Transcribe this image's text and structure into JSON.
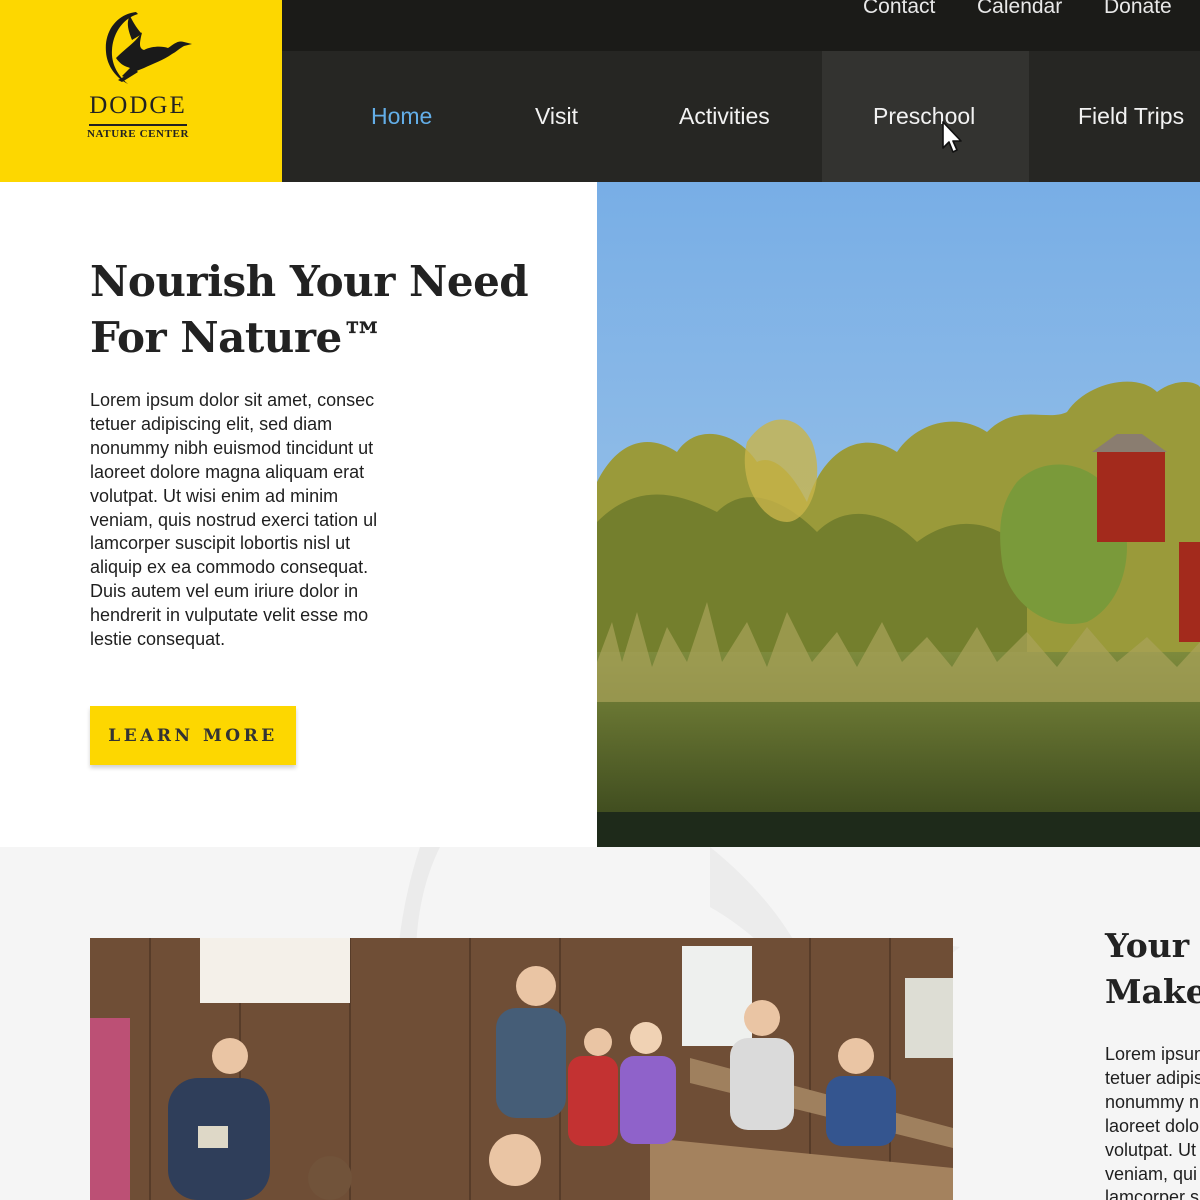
{
  "brand": {
    "name": "DODGE",
    "subtitle": "NATURE CENTER",
    "logo_icon": "heron-icon",
    "color_yellow": "#fdd700"
  },
  "utility_nav": [
    "Contact",
    "Calendar",
    "Donate"
  ],
  "main_nav": {
    "items": [
      "Home",
      "Visit",
      "Activities",
      "Preschool",
      "Field Trips"
    ],
    "active": "Home",
    "hovered": "Preschool",
    "active_color": "#63aee8"
  },
  "hero": {
    "title_line1": "Nourish Your Need",
    "title_line2": "For Nature™",
    "body": "Lorem ipsum dolor sit amet, consec tetuer adipiscing elit, sed diam nonummy nibh euismod tincidunt ut laoreet dolore magna aliquam erat volutpat. Ut wisi enim ad minim veniam, quis nostrud exerci tation ul lamcorper suscipit lobortis nisl ut aliquip ex ea commodo consequat. Duis autem vel eum iriure dolor in hendrerit in vulputate velit esse mo lestie consequat.",
    "button_label": "LEARN MORE",
    "image": "nature-landscape-with-red-barn"
  },
  "section2": {
    "title_line1": "Your N",
    "title_line2": "Make",
    "body": "Lorem ipsum\ntetuer adipis\nnonummy ni\nlaoreet dolo\nvolutpat. Ut\nveniam, qui\nlamcorper s",
    "image": "children-in-barn"
  }
}
